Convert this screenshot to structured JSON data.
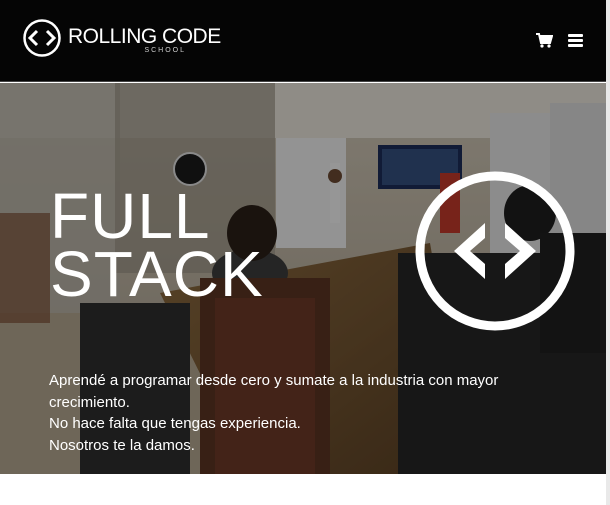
{
  "header": {
    "logo_title": "ROLLING CODE",
    "logo_subtitle": "SCHOOL",
    "cart_icon": "shopping-cart-icon",
    "menu_icon": "hamburger-menu-icon"
  },
  "hero": {
    "title_line1": "FULL",
    "title_line2": "STACK",
    "logo_icon": "code-brackets-icon",
    "text_line1": "Aprendé a programar desde cero y sumate a la industria con mayor",
    "text_line2": "crecimiento.",
    "text_line3": "No hace falta que tengas experiencia.",
    "text_line4": "Nosotros te la damos."
  },
  "colors": {
    "header_bg": "#050505",
    "text": "#ffffff",
    "page_bg": "#ffffff"
  }
}
